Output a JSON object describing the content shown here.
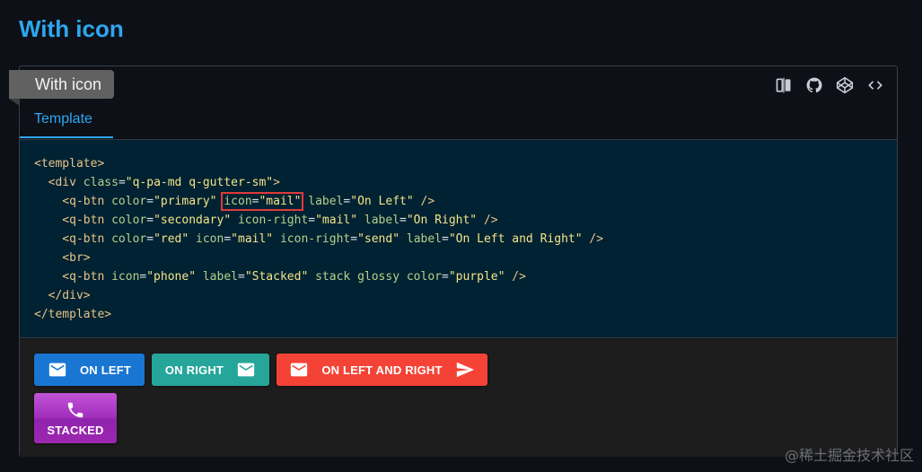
{
  "page": {
    "title": "With icon"
  },
  "card": {
    "badge_label": "With icon",
    "tab_label": "Template",
    "toolbar": [
      {
        "icon": "swap-card-icon"
      },
      {
        "icon": "github-icon"
      },
      {
        "icon": "codepen-icon"
      },
      {
        "icon": "code-icon"
      }
    ]
  },
  "code": {
    "l1_open": "<template>",
    "l2_a": "  <div ",
    "l2_attr": "class",
    "l2_eq": "=",
    "l2_val": "\"q-pa-md q-gutter-sm\"",
    "l2_close": ">",
    "l3_a": "    <q-btn ",
    "l3_attr1": "color",
    "l3_val1": "\"primary\"",
    "l3_hl_attr": "icon",
    "l3_hl_val": "\"mail\"",
    "l3_attr3": "label",
    "l3_val3": "\"On Left\"",
    "l3_end": " />",
    "l4_a": "    <q-btn ",
    "l4_attr1": "color",
    "l4_val1": "\"secondary\"",
    "l4_attr2": "icon-right",
    "l4_val2": "\"mail\"",
    "l4_attr3": "label",
    "l4_val3": "\"On Right\"",
    "l4_end": " />",
    "l5_a": "    <q-btn ",
    "l5_attr1": "color",
    "l5_val1": "\"red\"",
    "l5_attr2": "icon",
    "l5_val2": "\"mail\"",
    "l5_attr3": "icon-right",
    "l5_val3": "\"send\"",
    "l5_attr4": "label",
    "l5_val4": "\"On Left and Right\"",
    "l5_end": " />",
    "l6": "    <br>",
    "l7_a": "    <q-btn ",
    "l7_attr1": "icon",
    "l7_val1": "\"phone\"",
    "l7_attr2": "label",
    "l7_val2": "\"Stacked\"",
    "l7_flags": "stack glossy",
    "l7_attr3": "color",
    "l7_val3": "\"purple\"",
    "l7_end": " />",
    "l8": "  </div>",
    "l9": "</template>"
  },
  "demo": {
    "buttons": [
      {
        "label": "ON LEFT",
        "color": "#1976d2",
        "left_icon": "mail-icon"
      },
      {
        "label": "ON RIGHT",
        "color": "#26a69a",
        "right_icon": "mail-icon"
      },
      {
        "label": "ON LEFT AND RIGHT",
        "color": "#f44336",
        "left_icon": "mail-icon",
        "right_icon": "send-icon"
      },
      {
        "label": "STACKED",
        "color": "#9c27b0",
        "top_icon": "phone-icon"
      }
    ]
  },
  "watermark": "@稀土掘金技术社区"
}
